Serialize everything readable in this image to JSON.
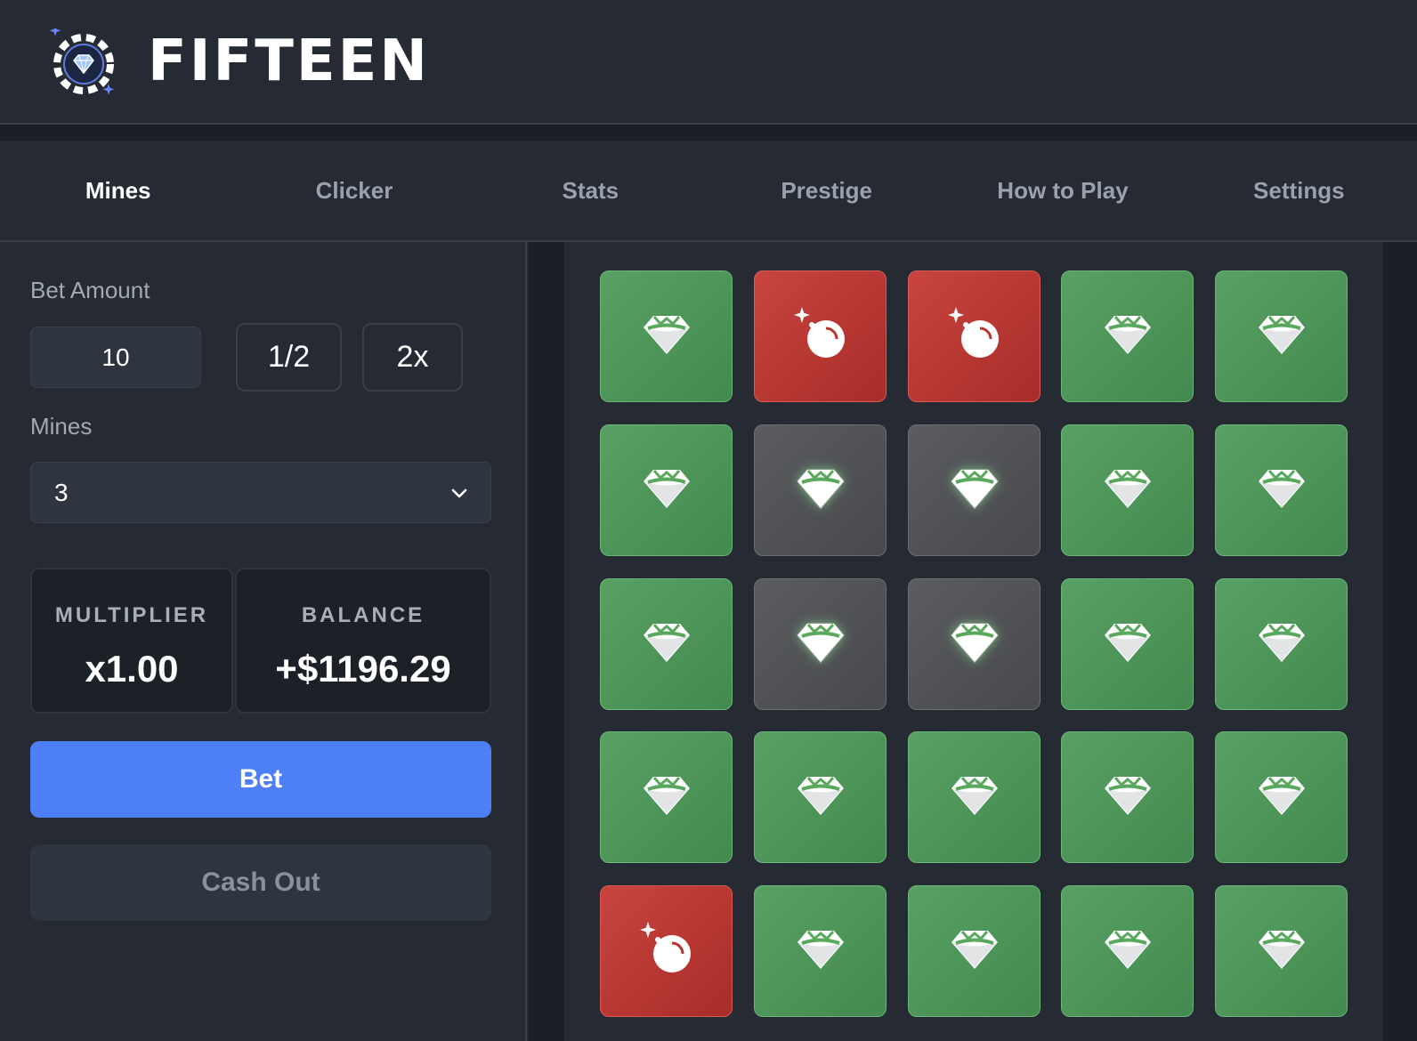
{
  "header": {
    "title": "FIFTEEN",
    "logo_icon": "diamond-chip-logo-icon"
  },
  "tabs": [
    {
      "label": "Mines",
      "active": true
    },
    {
      "label": "Clicker",
      "active": false
    },
    {
      "label": "Stats",
      "active": false
    },
    {
      "label": "Prestige",
      "active": false
    },
    {
      "label": "How to Play",
      "active": false
    },
    {
      "label": "Settings",
      "active": false
    }
  ],
  "controls": {
    "bet_amount_label": "Bet Amount",
    "bet_amount_value": "10",
    "half_label": "1/2",
    "double_label": "2x",
    "mines_label": "Mines",
    "mines_value": "3",
    "multiplier_title": "MULTIPLIER",
    "multiplier_value": "x1.00",
    "balance_title": "BALANCE",
    "balance_value": "+$1196.29",
    "bet_label": "Bet",
    "cashout_label": "Cash Out"
  },
  "colors": {
    "accent": "#4d7ff7",
    "gem_tile": "#4f9559",
    "mine_tile": "#b8362f",
    "revealed_tile": "#515356",
    "background": "#252a33"
  },
  "board": {
    "rows": 5,
    "cols": 5,
    "tiles": [
      [
        "gem",
        "mine",
        "mine",
        "gem",
        "gem"
      ],
      [
        "gem",
        "revealed",
        "revealed",
        "gem",
        "gem"
      ],
      [
        "gem",
        "revealed",
        "revealed",
        "gem",
        "gem"
      ],
      [
        "gem",
        "gem",
        "gem",
        "gem",
        "gem"
      ],
      [
        "mine",
        "gem",
        "gem",
        "gem",
        "gem"
      ]
    ]
  }
}
